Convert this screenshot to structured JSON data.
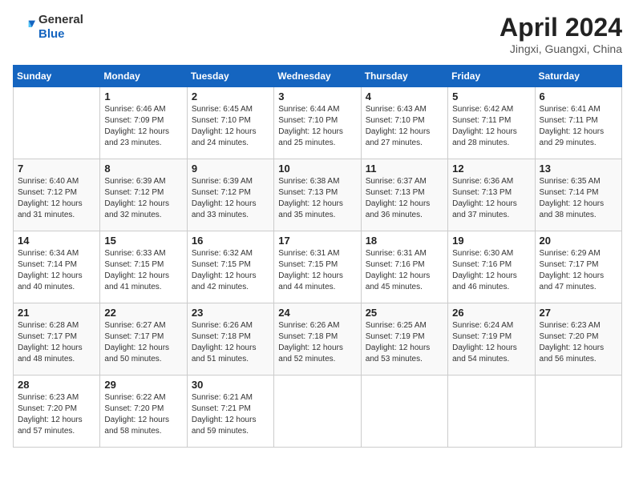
{
  "header": {
    "logo_general": "General",
    "logo_blue": "Blue",
    "month_title": "April 2024",
    "location": "Jingxi, Guangxi, China"
  },
  "days_of_week": [
    "Sunday",
    "Monday",
    "Tuesday",
    "Wednesday",
    "Thursday",
    "Friday",
    "Saturday"
  ],
  "weeks": [
    [
      {
        "day": "",
        "sunrise": "",
        "sunset": "",
        "daylight": ""
      },
      {
        "day": "1",
        "sunrise": "Sunrise: 6:46 AM",
        "sunset": "Sunset: 7:09 PM",
        "daylight": "Daylight: 12 hours and 23 minutes."
      },
      {
        "day": "2",
        "sunrise": "Sunrise: 6:45 AM",
        "sunset": "Sunset: 7:10 PM",
        "daylight": "Daylight: 12 hours and 24 minutes."
      },
      {
        "day": "3",
        "sunrise": "Sunrise: 6:44 AM",
        "sunset": "Sunset: 7:10 PM",
        "daylight": "Daylight: 12 hours and 25 minutes."
      },
      {
        "day": "4",
        "sunrise": "Sunrise: 6:43 AM",
        "sunset": "Sunset: 7:10 PM",
        "daylight": "Daylight: 12 hours and 27 minutes."
      },
      {
        "day": "5",
        "sunrise": "Sunrise: 6:42 AM",
        "sunset": "Sunset: 7:11 PM",
        "daylight": "Daylight: 12 hours and 28 minutes."
      },
      {
        "day": "6",
        "sunrise": "Sunrise: 6:41 AM",
        "sunset": "Sunset: 7:11 PM",
        "daylight": "Daylight: 12 hours and 29 minutes."
      }
    ],
    [
      {
        "day": "7",
        "sunrise": "Sunrise: 6:40 AM",
        "sunset": "Sunset: 7:12 PM",
        "daylight": "Daylight: 12 hours and 31 minutes."
      },
      {
        "day": "8",
        "sunrise": "Sunrise: 6:39 AM",
        "sunset": "Sunset: 7:12 PM",
        "daylight": "Daylight: 12 hours and 32 minutes."
      },
      {
        "day": "9",
        "sunrise": "Sunrise: 6:39 AM",
        "sunset": "Sunset: 7:12 PM",
        "daylight": "Daylight: 12 hours and 33 minutes."
      },
      {
        "day": "10",
        "sunrise": "Sunrise: 6:38 AM",
        "sunset": "Sunset: 7:13 PM",
        "daylight": "Daylight: 12 hours and 35 minutes."
      },
      {
        "day": "11",
        "sunrise": "Sunrise: 6:37 AM",
        "sunset": "Sunset: 7:13 PM",
        "daylight": "Daylight: 12 hours and 36 minutes."
      },
      {
        "day": "12",
        "sunrise": "Sunrise: 6:36 AM",
        "sunset": "Sunset: 7:13 PM",
        "daylight": "Daylight: 12 hours and 37 minutes."
      },
      {
        "day": "13",
        "sunrise": "Sunrise: 6:35 AM",
        "sunset": "Sunset: 7:14 PM",
        "daylight": "Daylight: 12 hours and 38 minutes."
      }
    ],
    [
      {
        "day": "14",
        "sunrise": "Sunrise: 6:34 AM",
        "sunset": "Sunset: 7:14 PM",
        "daylight": "Daylight: 12 hours and 40 minutes."
      },
      {
        "day": "15",
        "sunrise": "Sunrise: 6:33 AM",
        "sunset": "Sunset: 7:15 PM",
        "daylight": "Daylight: 12 hours and 41 minutes."
      },
      {
        "day": "16",
        "sunrise": "Sunrise: 6:32 AM",
        "sunset": "Sunset: 7:15 PM",
        "daylight": "Daylight: 12 hours and 42 minutes."
      },
      {
        "day": "17",
        "sunrise": "Sunrise: 6:31 AM",
        "sunset": "Sunset: 7:15 PM",
        "daylight": "Daylight: 12 hours and 44 minutes."
      },
      {
        "day": "18",
        "sunrise": "Sunrise: 6:31 AM",
        "sunset": "Sunset: 7:16 PM",
        "daylight": "Daylight: 12 hours and 45 minutes."
      },
      {
        "day": "19",
        "sunrise": "Sunrise: 6:30 AM",
        "sunset": "Sunset: 7:16 PM",
        "daylight": "Daylight: 12 hours and 46 minutes."
      },
      {
        "day": "20",
        "sunrise": "Sunrise: 6:29 AM",
        "sunset": "Sunset: 7:17 PM",
        "daylight": "Daylight: 12 hours and 47 minutes."
      }
    ],
    [
      {
        "day": "21",
        "sunrise": "Sunrise: 6:28 AM",
        "sunset": "Sunset: 7:17 PM",
        "daylight": "Daylight: 12 hours and 48 minutes."
      },
      {
        "day": "22",
        "sunrise": "Sunrise: 6:27 AM",
        "sunset": "Sunset: 7:17 PM",
        "daylight": "Daylight: 12 hours and 50 minutes."
      },
      {
        "day": "23",
        "sunrise": "Sunrise: 6:26 AM",
        "sunset": "Sunset: 7:18 PM",
        "daylight": "Daylight: 12 hours and 51 minutes."
      },
      {
        "day": "24",
        "sunrise": "Sunrise: 6:26 AM",
        "sunset": "Sunset: 7:18 PM",
        "daylight": "Daylight: 12 hours and 52 minutes."
      },
      {
        "day": "25",
        "sunrise": "Sunrise: 6:25 AM",
        "sunset": "Sunset: 7:19 PM",
        "daylight": "Daylight: 12 hours and 53 minutes."
      },
      {
        "day": "26",
        "sunrise": "Sunrise: 6:24 AM",
        "sunset": "Sunset: 7:19 PM",
        "daylight": "Daylight: 12 hours and 54 minutes."
      },
      {
        "day": "27",
        "sunrise": "Sunrise: 6:23 AM",
        "sunset": "Sunset: 7:20 PM",
        "daylight": "Daylight: 12 hours and 56 minutes."
      }
    ],
    [
      {
        "day": "28",
        "sunrise": "Sunrise: 6:23 AM",
        "sunset": "Sunset: 7:20 PM",
        "daylight": "Daylight: 12 hours and 57 minutes."
      },
      {
        "day": "29",
        "sunrise": "Sunrise: 6:22 AM",
        "sunset": "Sunset: 7:20 PM",
        "daylight": "Daylight: 12 hours and 58 minutes."
      },
      {
        "day": "30",
        "sunrise": "Sunrise: 6:21 AM",
        "sunset": "Sunset: 7:21 PM",
        "daylight": "Daylight: 12 hours and 59 minutes."
      },
      {
        "day": "",
        "sunrise": "",
        "sunset": "",
        "daylight": ""
      },
      {
        "day": "",
        "sunrise": "",
        "sunset": "",
        "daylight": ""
      },
      {
        "day": "",
        "sunrise": "",
        "sunset": "",
        "daylight": ""
      },
      {
        "day": "",
        "sunrise": "",
        "sunset": "",
        "daylight": ""
      }
    ]
  ]
}
